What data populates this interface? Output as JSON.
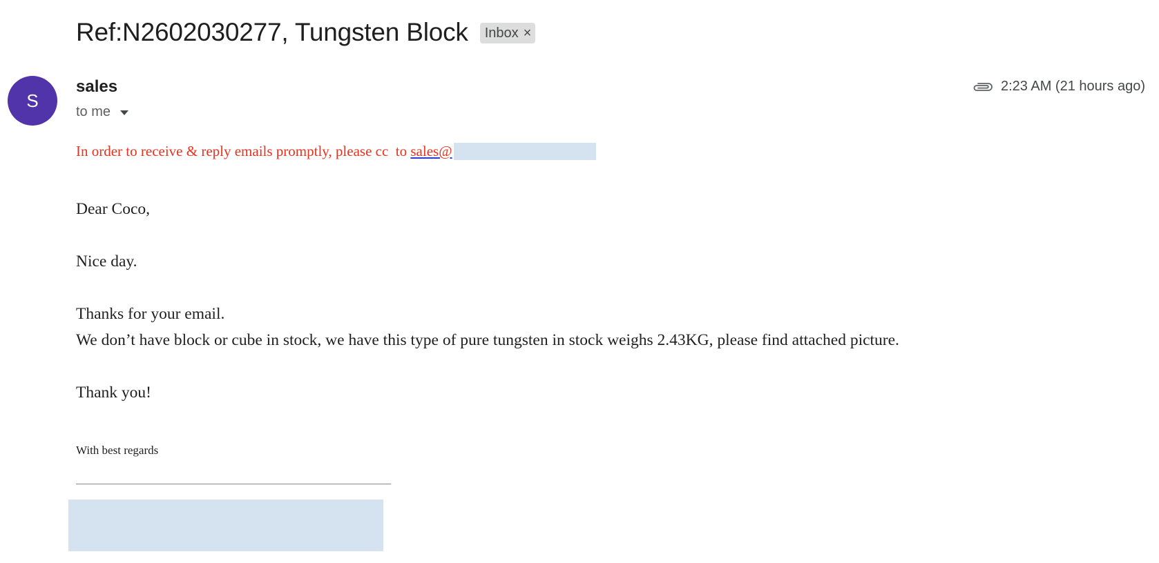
{
  "email": {
    "subject": "Ref:N2602030277, Tungsten Block",
    "label": "Inbox",
    "label_remove": "×",
    "sender": {
      "initial": "S",
      "name": "sales",
      "to_text": "to me",
      "avatar_color": "#5133aa"
    },
    "timestamp": "2:23 AM (21 hours ago)",
    "attachment_icon": "paperclip-icon",
    "notice": {
      "text": "In order to receive & reply emails promptly, please cc  to ",
      "link_text": "sales@",
      "color": "#e8321f"
    },
    "body": {
      "greeting": "Dear Coco,",
      "line1": "Nice day.",
      "line2": "Thanks for your email.",
      "line3": "We don’t have block or cube in stock, we have this type of pure tungsten in stock weighs 2.43KG, please find attached picture.",
      "closing": "Thank you!",
      "regards": "With best regards"
    }
  },
  "colors": {
    "redaction": "#d5e2f0",
    "text": "#1f1f1f",
    "chip_bg": "#dddddd"
  }
}
